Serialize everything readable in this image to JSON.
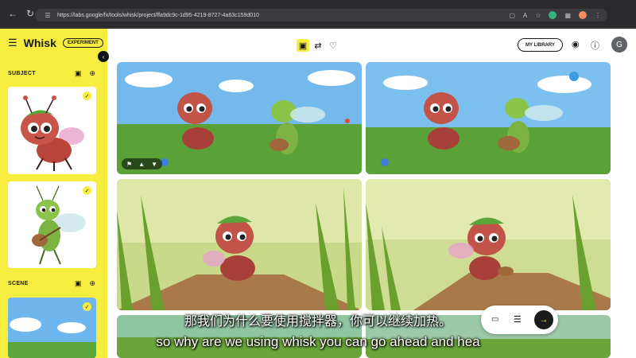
{
  "browser": {
    "url": "https://labs.google/fx/tools/whisk/project/ffa9dc9c-1d95-4219-8727-4a63c159d010",
    "reader_label": "A"
  },
  "app": {
    "name": "Whisk",
    "badge": "EXPERIMENT",
    "library_button": "MY LIBRARY",
    "avatar_initial": "G",
    "accent_color": "#f7ed3f"
  },
  "sidebar": {
    "subject_title": "SUBJECT",
    "scene_title": "SCENE"
  },
  "subtitles": {
    "chinese": "那我们为什么要使用搅拌器，你可以继续加热。",
    "english": "so why are we using whisk you can go ahead and hea"
  }
}
